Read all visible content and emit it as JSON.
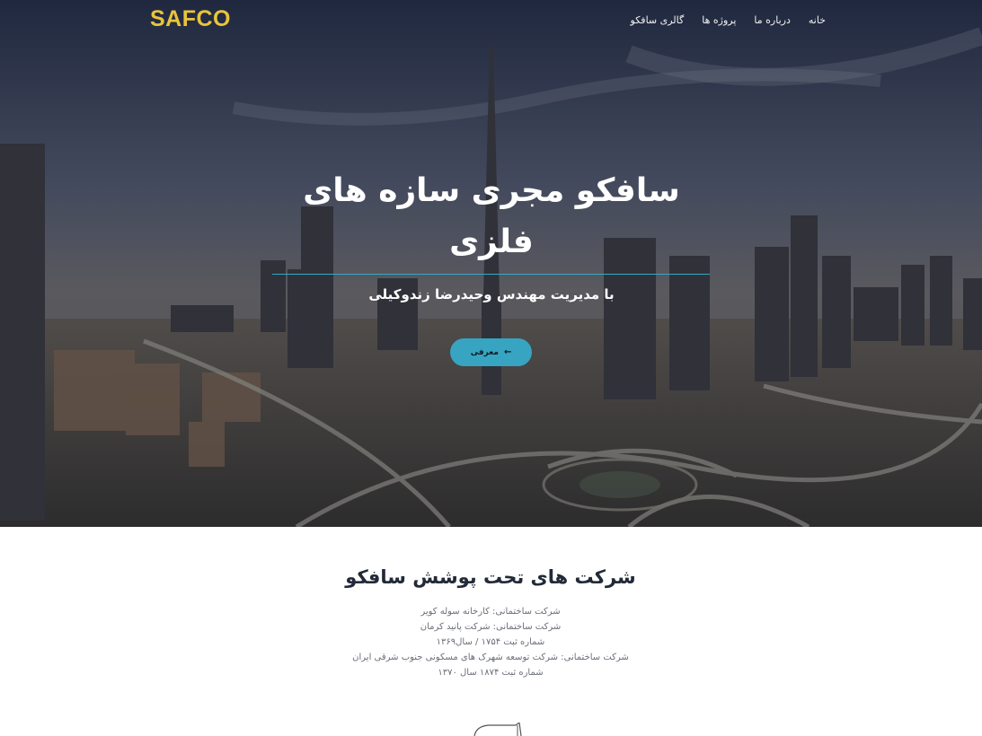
{
  "brand": {
    "logo_text": "SAFCO",
    "logo_color": "#e8c53a"
  },
  "nav": {
    "items": [
      {
        "label": "خانه"
      },
      {
        "label": "درباره ما"
      },
      {
        "label": "پروژه ها"
      },
      {
        "label": "گالری سافکو"
      }
    ]
  },
  "hero": {
    "title": "سافکو مجری سازه های فلزی",
    "subtitle": "با مدیریت مهندس وحیدرضا زندوکیلی",
    "button_label": "معرفی",
    "button_icon": "arrow-left-icon",
    "accent_color": "#37a4c2"
  },
  "companies": {
    "heading": "شرکت های تحت پوشش سافکو",
    "lines": [
      "شرکت ساختمانی: کارخانه سوله کویر",
      "شرکت ساختمانی: شرکت پانید کرمان",
      "شماره ثبت ۱۷۵۴ / سال۱۳۶۹",
      "شرکت ساختمانی: شرکت توسعه شهرک های مسکونی جنوب شرقی ایران",
      "شماره ثبت ۱۸۷۴ سال ۱۳۷۰"
    ]
  }
}
